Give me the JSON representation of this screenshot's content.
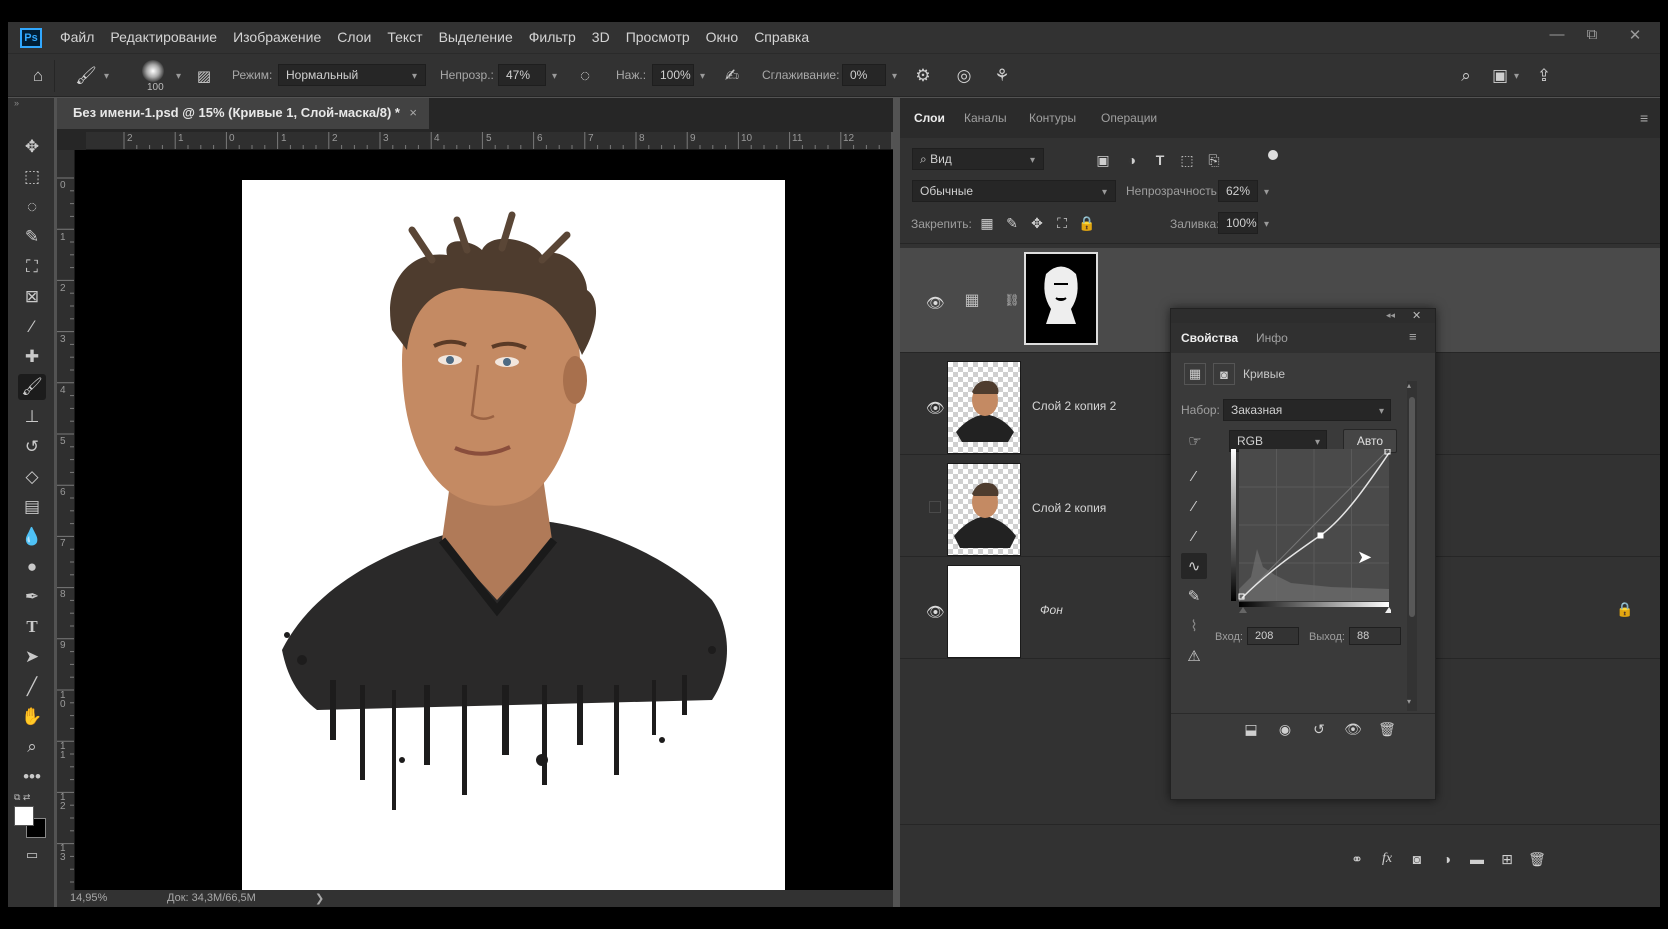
{
  "app": {
    "logo": "Ps",
    "accent": "#31a8ff"
  },
  "menu": [
    "Файл",
    "Редактирование",
    "Изображение",
    "Слои",
    "Текст",
    "Выделение",
    "Фильтр",
    "3D",
    "Просмотр",
    "Окно",
    "Справка"
  ],
  "window_controls": {
    "minimize": "—",
    "restore": "⧉",
    "close": "✕"
  },
  "options": {
    "brush_size": "100",
    "mode_label": "Режим:",
    "mode_value": "Нормальный",
    "opacity_label": "Непрозр.:",
    "opacity_value": "47%",
    "pressure_label": "Наж.:",
    "pressure_value": "100%",
    "smoothing_label": "Сглаживание:",
    "smoothing_value": "0%"
  },
  "document": {
    "tab_title": "Без имени-1.psd @ 15% (Кривые 1, Слой-маска/8) *",
    "tab_close": "×",
    "ruler_top": [
      "2",
      "1",
      "0",
      "1",
      "2",
      "3",
      "4",
      "5",
      "6",
      "7",
      "8",
      "9",
      "10",
      "11",
      "12"
    ],
    "ruler_left": [
      "0",
      "1",
      "2",
      "3",
      "4",
      "5",
      "6",
      "7",
      "8",
      "9",
      "1 0",
      "1 1",
      "1 2",
      "1 3"
    ],
    "zoom": "14,95%",
    "doc_size": "Док: 34,3M/66,5M",
    "arrow": "❯"
  },
  "layers_panel": {
    "tabs": [
      "Слои",
      "Каналы",
      "Контуры",
      "Операции"
    ],
    "filter_value": "Вид",
    "blend_mode": "Обычные",
    "opacity_label": "Непрозрачность:",
    "opacity_value": "62%",
    "lock_label": "Закрепить:",
    "fill_label": "Заливка:",
    "fill_value": "100%",
    "layers": [
      {
        "name": "",
        "visible": true,
        "type": "curves-adjustment"
      },
      {
        "name": "Слой 2 копия 2",
        "visible": true,
        "type": "pixel"
      },
      {
        "name": "Слой 2 копия",
        "visible": false,
        "type": "pixel"
      },
      {
        "name": "Фон",
        "visible": true,
        "type": "background"
      }
    ]
  },
  "properties": {
    "tabs": [
      "Свойства",
      "Инфо"
    ],
    "adjustment_name": "Кривые",
    "preset_label": "Набор:",
    "preset_value": "Заказная",
    "channel_value": "RGB",
    "auto_label": "Авто",
    "input_label": "Вход:",
    "input_value": "208",
    "output_label": "Выход:",
    "output_value": "88",
    "collapse": "◂◂",
    "close": "✕",
    "menu": "≡"
  },
  "colors": {
    "panel": "#323232",
    "workspace": "#262626",
    "dialog": "#3a3a3a",
    "selected_row": "#4a4a4a"
  }
}
